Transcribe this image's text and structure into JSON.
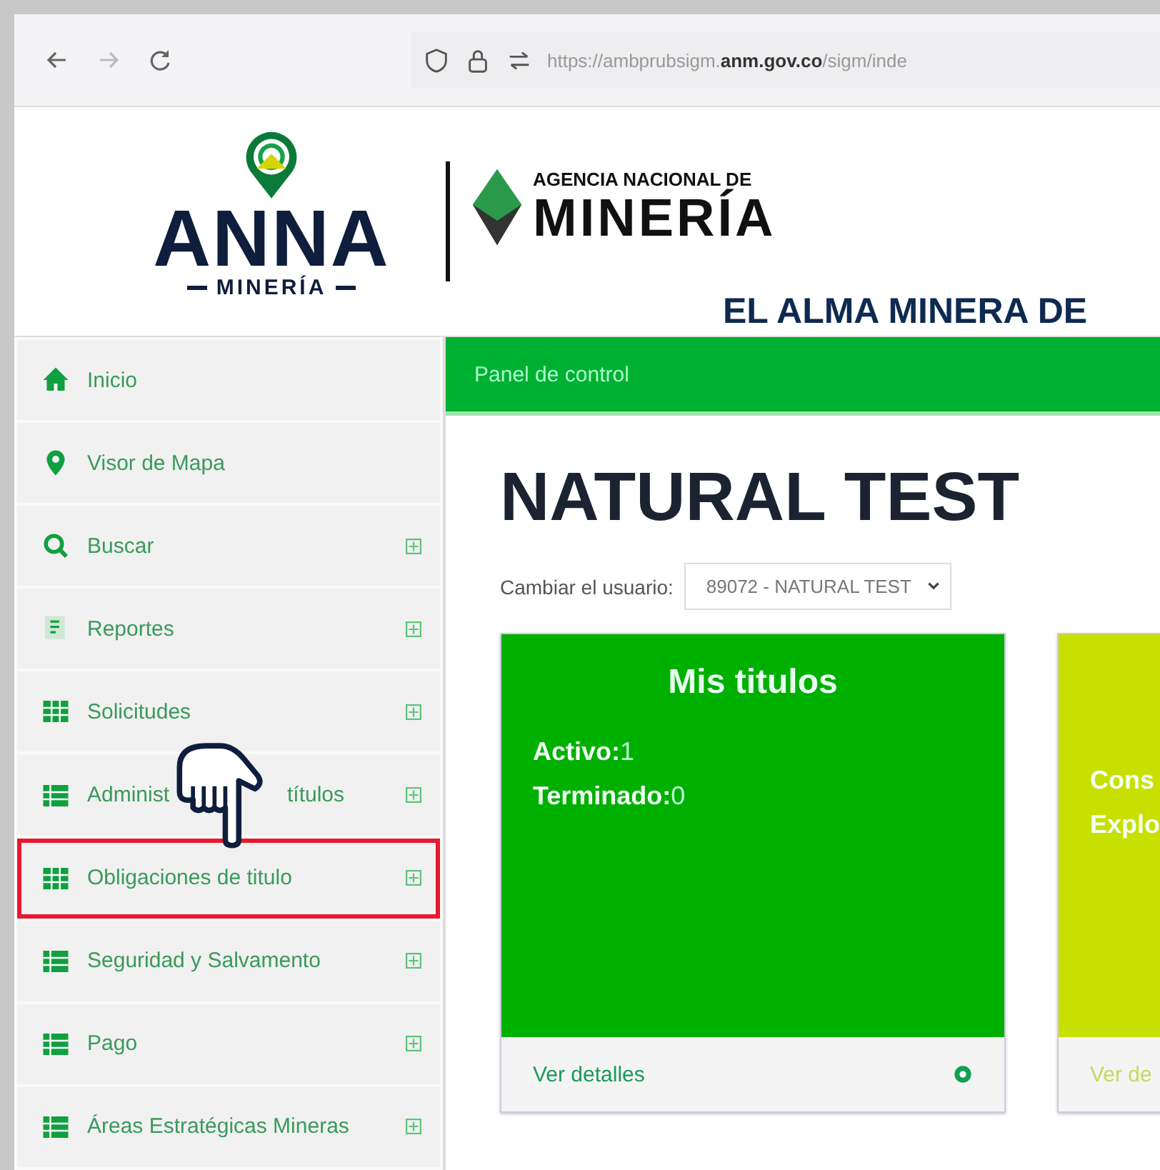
{
  "browser": {
    "url": "https://ambprubsigm.**anm.gov.co**/sigm/inde"
  },
  "header": {
    "logo_text": "ANNA",
    "logo_sub": "MINERÍA",
    "agency_top": "AGENCIA NACIONAL DE",
    "agency_name": "MINERÍA",
    "tagline": "EL ALMA MINERA DE"
  },
  "sidebar": {
    "items": [
      {
        "label": "Inicio",
        "kind": "home",
        "expandable": false,
        "highlighted": false
      },
      {
        "label": "Visor de Mapa",
        "kind": "pin",
        "expandable": false,
        "highlighted": false
      },
      {
        "label": "Buscar",
        "kind": "search",
        "expandable": true,
        "highlighted": false
      },
      {
        "label": "Reportes",
        "kind": "report",
        "expandable": true,
        "highlighted": false
      },
      {
        "label": "Solicitudes",
        "kind": "grid",
        "expandable": true,
        "highlighted": false
      },
      {
        "label": "Administ",
        "label_end": "títulos",
        "kind": "list",
        "expandable": true,
        "highlighted": false
      },
      {
        "label": "Obligaciones de titulo",
        "kind": "grid",
        "expandable": true,
        "highlighted": true
      },
      {
        "label": "Seguridad y Salvamento",
        "kind": "list",
        "expandable": true,
        "highlighted": false
      },
      {
        "label": "Pago",
        "kind": "list",
        "expandable": true,
        "highlighted": false
      },
      {
        "label": "Áreas Estratégicas Mineras",
        "kind": "list",
        "expandable": true,
        "highlighted": false
      }
    ]
  },
  "breadcrumb": "Panel de control",
  "title": "NATURAL TEST",
  "user_select": {
    "label": "Cambiar el usuario:",
    "value": "89072 - NATURAL TEST"
  },
  "cards": [
    {
      "title": "Mis titulos",
      "color": "#00b000",
      "lines": [
        {
          "label": "Activo:",
          "value": "1"
        },
        {
          "label": "Terminado:",
          "value": "0"
        }
      ],
      "link": "Ver detalles"
    },
    {
      "color": "#c8e000",
      "lines": [
        {
          "label": "Cons"
        },
        {
          "label": "Explo"
        }
      ],
      "link": "Ver de"
    }
  ]
}
